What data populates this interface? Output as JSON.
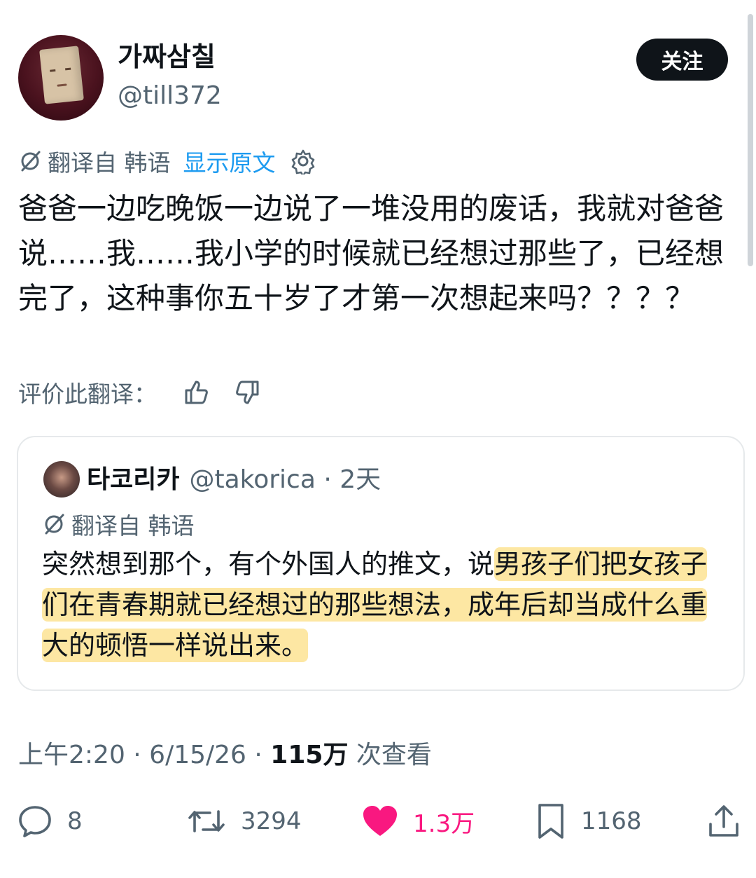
{
  "author": {
    "display_name": "가짜삼칠",
    "handle": "@till372"
  },
  "follow_label": "关注",
  "translation": {
    "label": "翻译自 韩语",
    "show_original": "显示原文"
  },
  "tweet_text": "爸爸一边吃晚饭一边说了一堆没用的废话，我就对爸爸说……我……我小学的时候就已经想过那些了，已经想完了，这种事你五十岁了才第一次想起来吗？？？？",
  "rate_label": "评价此翻译：",
  "quote": {
    "name": "타코리카",
    "meta": "@takorica · 2天",
    "translation_label": "翻译自 韩语",
    "text_plain": "突然想到那个，有个外国人的推文，说",
    "text_highlight": "男孩子们把女孩子们在青春期就已经想过的那些想法，成年后却当成什么重大的顿悟一样说出来。",
    "highlight_color": "#fde7a3"
  },
  "timestamp": {
    "time_date": "上午2:20 · 6/15/26 · ",
    "views_count": "115万",
    "views_label": " 次查看"
  },
  "actions": {
    "replies": "8",
    "retweets": "3294",
    "likes": "1.3万",
    "bookmarks": "1168"
  },
  "icons": {
    "translate": "translate-slash-icon",
    "settings": "gear-icon",
    "thumbs_up": "thumbs-up-icon",
    "thumbs_down": "thumbs-down-icon",
    "reply": "reply-icon",
    "retweet": "retweet-icon",
    "like": "heart-icon",
    "bookmark": "bookmark-icon",
    "share": "share-icon"
  },
  "colors": {
    "link": "#1d9bf0",
    "like": "#f91880",
    "muted": "#536471",
    "text": "#0f1419"
  }
}
